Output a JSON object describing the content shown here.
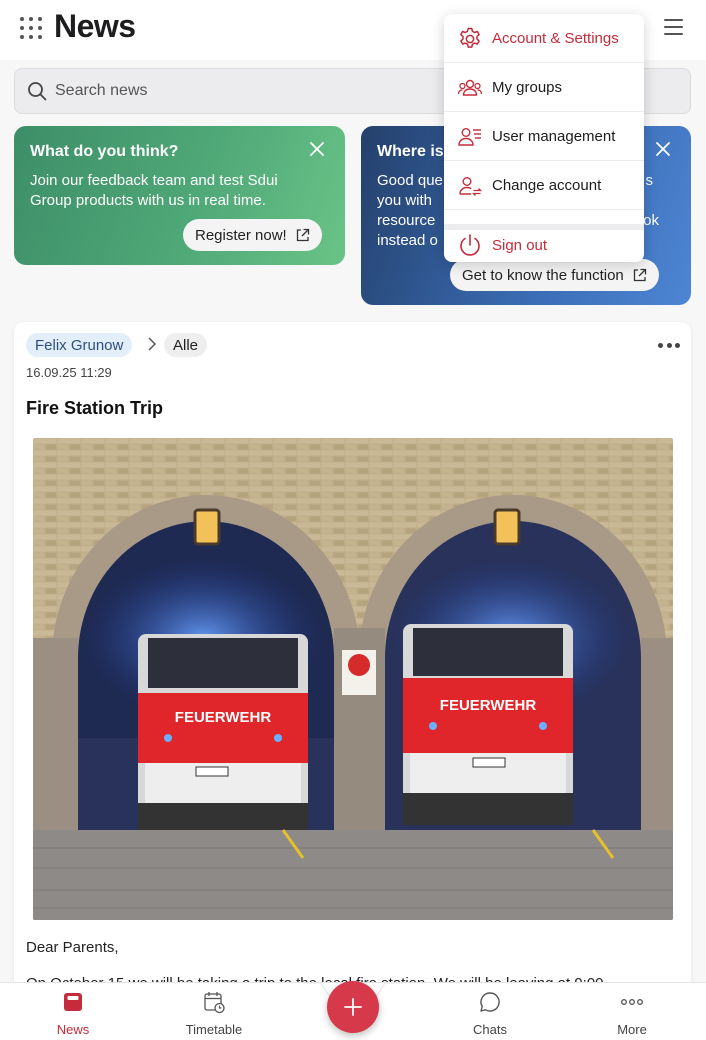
{
  "header": {
    "title": "News"
  },
  "search": {
    "placeholder": "Search news"
  },
  "promo_cards": [
    {
      "title": "What do you think?",
      "text": "Join our feedback team and test Sdui Group products with us in real time.",
      "button": "Register now!"
    },
    {
      "title": "Where is",
      "text_lines": [
        "Good que",
        "you with",
        "resource",
        "instead o"
      ],
      "text_tail": [
        "s",
        "",
        "ok",
        ""
      ],
      "button": "Get to know the function"
    }
  ],
  "account_menu": {
    "items": [
      {
        "label": "Account & Settings",
        "icon": "gear-icon",
        "style": "red"
      },
      {
        "label": "My groups",
        "icon": "group-icon",
        "style": "normal"
      },
      {
        "label": "User management",
        "icon": "user-list-icon",
        "style": "normal"
      },
      {
        "label": "Change account",
        "icon": "switch-user-icon",
        "style": "normal"
      },
      {
        "label": "Sign out",
        "icon": "power-icon",
        "style": "red"
      }
    ]
  },
  "post": {
    "author": "Felix Grunow",
    "group": "Alle",
    "date": "16.09.25 11:29",
    "title": "Fire Station Trip",
    "image_alt": "Two red fire trucks labeled FEUERWEHR parked under brick arches",
    "truck_label": "FEUERWEHR",
    "body": "Dear Parents,",
    "body_line2": "On October 15 we will be taking a trip to the local fire station. We will be leaving at 9:00"
  },
  "bottom_nav": {
    "items": [
      {
        "label": "News",
        "icon": "news-icon",
        "active": true
      },
      {
        "label": "Timetable",
        "icon": "calendar-clock-icon",
        "active": false
      },
      {
        "label": "Chats",
        "icon": "chat-bubble-icon",
        "active": false
      },
      {
        "label": "More",
        "icon": "more-dots-icon",
        "active": false
      }
    ],
    "fab_icon": "plus-icon"
  },
  "colors": {
    "brand_red": "#c52b3a",
    "green_card": "#4fa877",
    "blue_card": "#3b6db6",
    "author_chip": "#e2eefa"
  }
}
